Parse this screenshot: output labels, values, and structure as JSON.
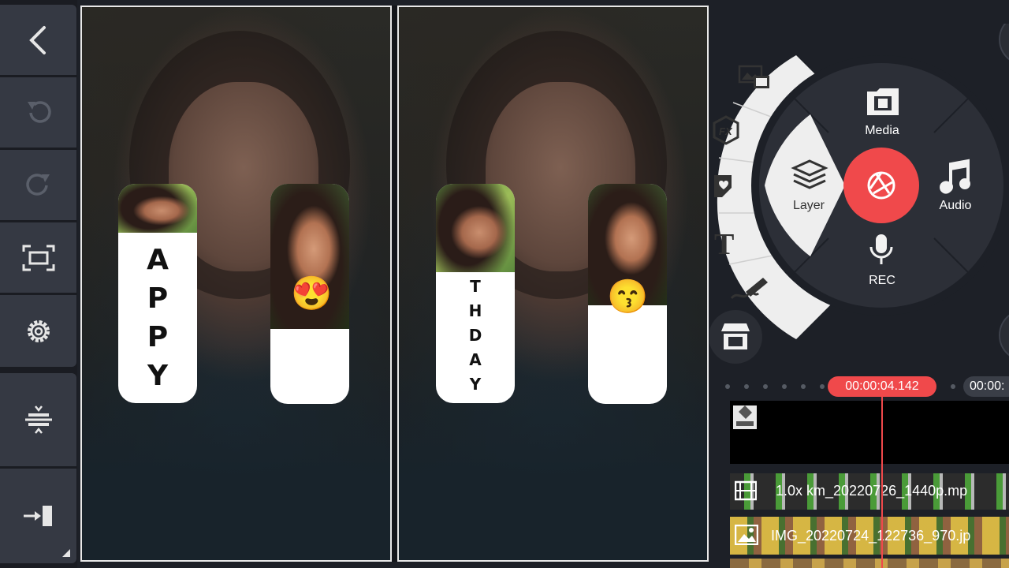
{
  "toolbar": {
    "items": [
      "back-icon",
      "undo-icon",
      "redo-icon",
      "fit-screen-icon",
      "settings-icon",
      "split-icon",
      "export-icon"
    ]
  },
  "preview": {
    "left_card_letters": [
      "A",
      "P",
      "P",
      "Y"
    ],
    "right_card_letters": [
      "T",
      "H",
      "D",
      "A",
      "Y"
    ],
    "emoji_left": "😍",
    "emoji_right": "😙"
  },
  "menu": {
    "media": "Media",
    "layer": "Layer",
    "audio": "Audio",
    "rec": "REC",
    "fx": "FX",
    "text_icon": "T"
  },
  "timeline": {
    "current_time": "00:00:04.142",
    "next_time": "00:00:",
    "video_clip_label": "1.0x km_20220726_1440p.mp",
    "image_clip_label": "IMG_20220724_122736_970.jp"
  },
  "colors": {
    "accent": "#f0494b",
    "panel": "#353943",
    "background": "#1d2027"
  }
}
